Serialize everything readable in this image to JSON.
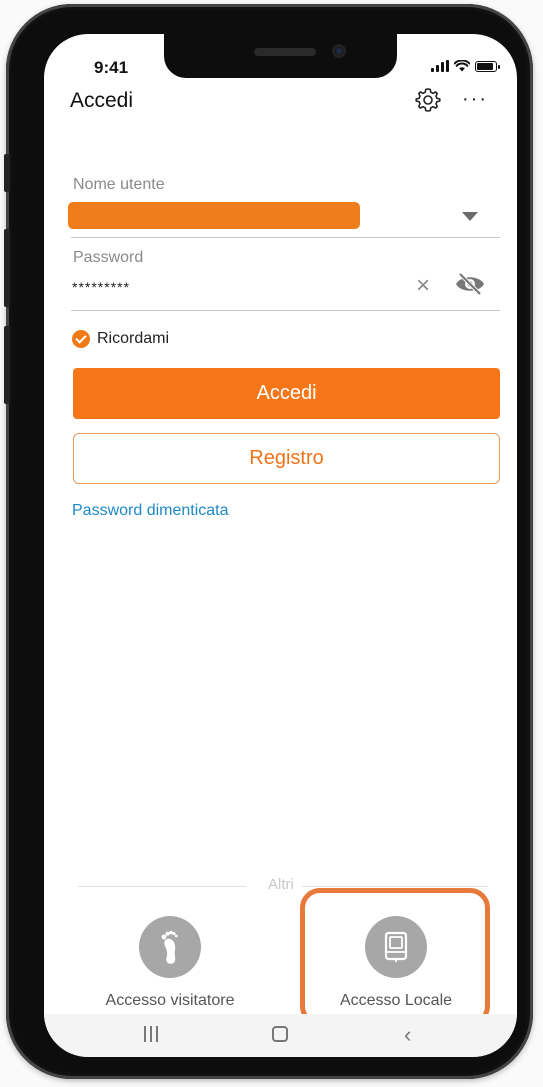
{
  "status_bar": {
    "time": "9:41"
  },
  "header": {
    "title": "Accedi",
    "settings_icon": "gear-icon",
    "more_label": "···"
  },
  "form": {
    "username_label": "Nome utente",
    "username_value": "",
    "password_label": "Password",
    "password_value": "*********",
    "clear_label": "×",
    "remember_label": "Ricordami",
    "remember_checked": true
  },
  "buttons": {
    "login_label": "Accedi",
    "register_label": "Registro"
  },
  "links": {
    "forgot_password": "Password dimenticata"
  },
  "others": {
    "label": "Altri",
    "items": [
      {
        "label": "Accesso visitatore",
        "icon": "footprint-icon"
      },
      {
        "label": "Accesso Locale",
        "icon": "device-icon"
      }
    ]
  },
  "colors": {
    "accent": "#f77718",
    "link": "#1f89c7",
    "highlight": "#e7793b"
  }
}
